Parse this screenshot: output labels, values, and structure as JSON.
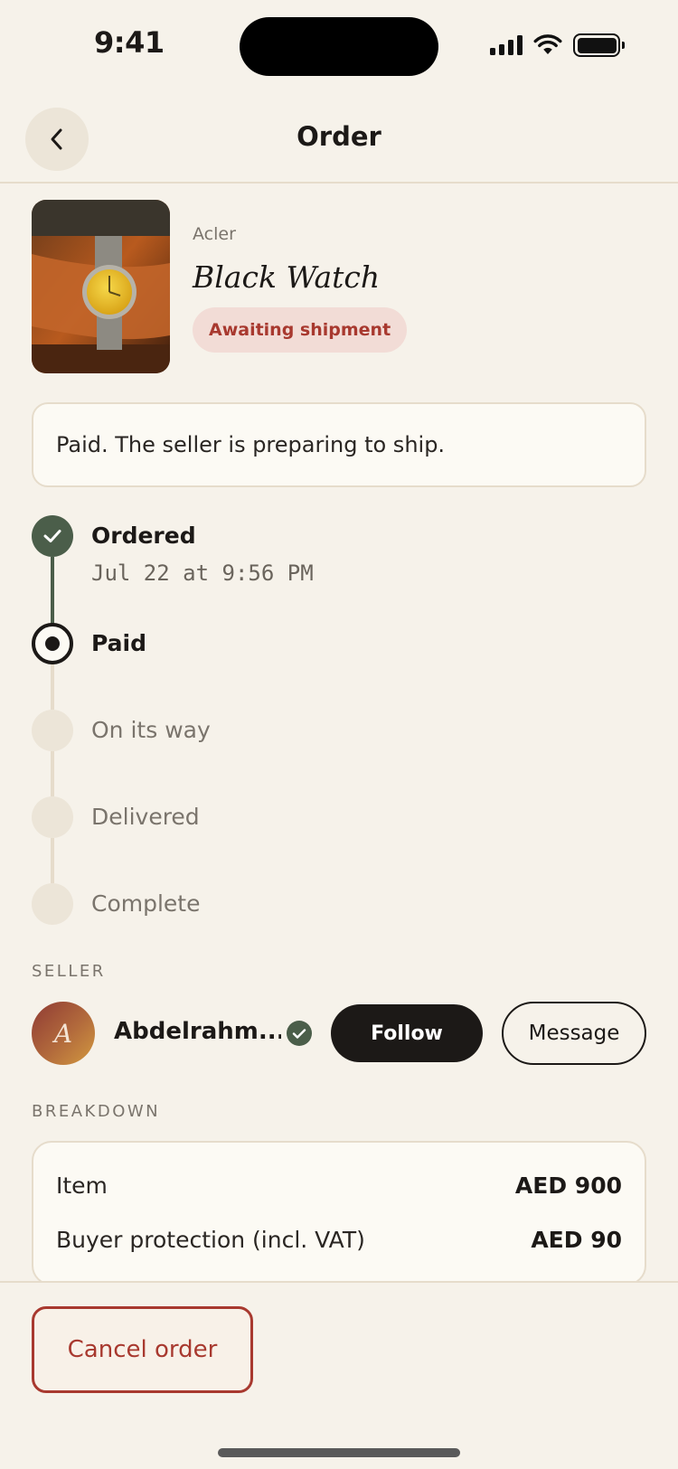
{
  "status_bar": {
    "time": "9:41"
  },
  "header": {
    "title": "Order"
  },
  "product": {
    "brand": "Acler",
    "name": "Black Watch",
    "status_badge": "Awaiting shipment"
  },
  "notice": "Paid. The seller is preparing to ship.",
  "timeline": {
    "steps": [
      {
        "label": "Ordered",
        "date": "Jul 22 at 9:56 PM",
        "state": "done"
      },
      {
        "label": "Paid",
        "state": "current"
      },
      {
        "label": "On its way",
        "state": "pending"
      },
      {
        "label": "Delivered",
        "state": "pending"
      },
      {
        "label": "Complete",
        "state": "pending"
      }
    ]
  },
  "seller": {
    "section_label": "SELLER",
    "avatar_initial": "A",
    "name": "Abdelrahm...",
    "follow_label": "Follow",
    "message_label": "Message"
  },
  "breakdown": {
    "section_label": "BREAKDOWN",
    "rows": [
      {
        "label": "Item",
        "value": "AED 900"
      },
      {
        "label": "Buyer protection (incl. VAT)",
        "value": "AED 90"
      }
    ]
  },
  "actions": {
    "cancel_label": "Cancel order"
  },
  "colors": {
    "background": "#f6f2ea",
    "card": "#fcfaf4",
    "done_green": "#4b5e4a",
    "danger": "#a8392f",
    "badge_bg": "#f2dcd6",
    "pending": "#ece5d8"
  }
}
